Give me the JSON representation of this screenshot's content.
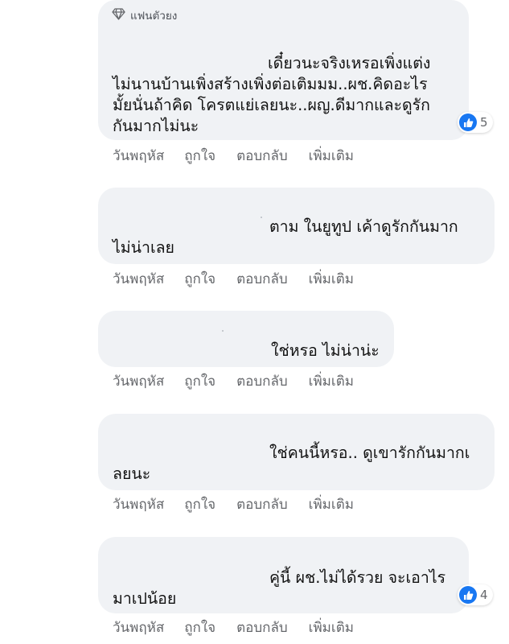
{
  "comments": [
    {
      "badge": "แฟนตัวยง",
      "lines": [
        "เดี๋ยวนะจริงเหรอเพิ่งแต่ง",
        "ไม่นานบ้านเพิ่งสร้างเพิ่งต่อเติมมม..ผช.คิดอะไร",
        "มั้ยนั่นถ้าคิด โครตแย่เลยนะ..ผญ.ดีมากและดูรัก",
        "กันมากไม่นะ"
      ],
      "reactions": "5"
    },
    {
      "lines": [
        "ตาม ในยูทูป เค้าดูรักกันมาก",
        "ไม่น่าเลย"
      ]
    },
    {
      "lines": [
        "ใช่หรอ ไม่น่าน่ะ"
      ]
    },
    {
      "lines": [
        "ใช่คนนี้หรอ.. ดูเขารักกันมากเ",
        "ลยนะ"
      ]
    },
    {
      "lines": [
        "คู่นี้ ผช.ไม่ได้รวย จะเอาไร",
        "มาเปน้อย"
      ],
      "reactions": "4"
    }
  ],
  "actions": {
    "time": "วันพฤหัส",
    "like": "ถูกใจ",
    "reply": "ตอบกลับ",
    "more": "เพิ่มเติม"
  },
  "colors": {
    "bubble": "#f0f2f5",
    "action_text": "#65676b",
    "like_blue": "#1877f2"
  }
}
